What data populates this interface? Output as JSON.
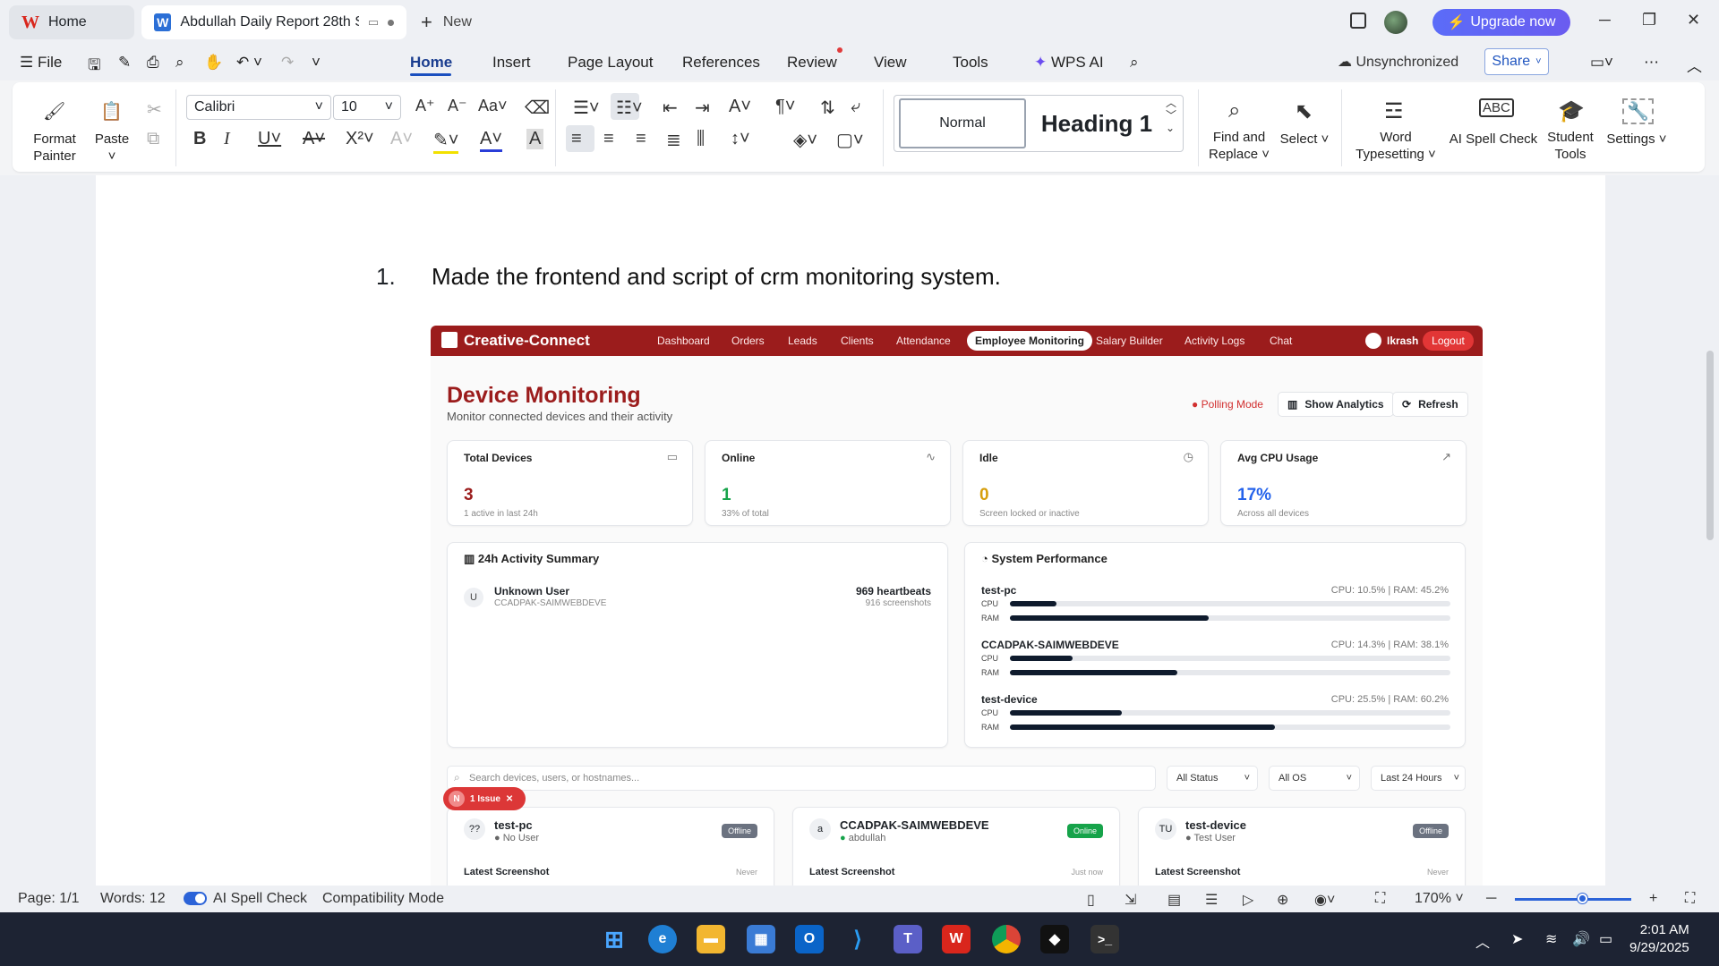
{
  "titlebar": {
    "home_tab": "Home",
    "doc_tab": "Abdullah Daily Report 28th S",
    "new_tab": "New",
    "upgrade": "Upgrade now"
  },
  "menu": {
    "file": "File",
    "tabs": [
      "Home",
      "Insert",
      "Page Layout",
      "References",
      "Review",
      "View",
      "Tools",
      "WPS AI"
    ],
    "unsync": "Unsynchronized",
    "share": "Share"
  },
  "ribbon": {
    "format_painter": [
      "Format",
      "Painter"
    ],
    "paste": "Paste",
    "font": "Calibri",
    "size": "10",
    "style_normal": "Normal",
    "style_h1": "Heading 1",
    "find_replace": [
      "Find and",
      "Replace"
    ],
    "select": "Select",
    "word_typesetting": [
      "Word",
      "Typesetting"
    ],
    "ai_spell": "AI Spell Check",
    "student_tools": [
      "Student",
      "Tools"
    ],
    "settings": "Settings"
  },
  "document": {
    "list_number": "1.",
    "line": "Made the frontend and script of crm monitoring system."
  },
  "crm": {
    "brand": "Creative-Connect",
    "nav": [
      "Dashboard",
      "Orders",
      "Leads",
      "Clients",
      "Attendance",
      "Employee Monitoring",
      "Salary Builder",
      "Activity Logs",
      "Chat"
    ],
    "user": "Ikrash",
    "logout": "Logout",
    "title": "Device Monitoring",
    "subtitle": "Monitor connected devices and their activity",
    "polling": "Polling Mode",
    "show_analytics": "Show Analytics",
    "refresh": "Refresh",
    "stats": [
      {
        "label": "Total Devices",
        "value": "3",
        "note": "1 active in last 24h",
        "color": "#9b1c1c"
      },
      {
        "label": "Online",
        "value": "1",
        "note": "33% of total",
        "color": "#16a34a"
      },
      {
        "label": "Idle",
        "value": "0",
        "note": "Screen locked or inactive",
        "color": "#d69e0b"
      },
      {
        "label": "Avg CPU Usage",
        "value": "17%",
        "note": "Across all devices",
        "color": "#2563eb"
      }
    ],
    "activity": {
      "title": "24h Activity Summary",
      "avatar": "U",
      "name": "Unknown User",
      "host": "CCADPAK-SAIMWEBDEVE",
      "heartbeats": "969 heartbeats",
      "screenshots": "916 screenshots"
    },
    "performance": {
      "title": "System Performance",
      "cpu_label": "CPU",
      "ram_label": "RAM",
      "devices": [
        {
          "name": "test-pc",
          "stat": "CPU: 10.5% | RAM: 45.2%",
          "cpu": 10.5,
          "ram": 45.2
        },
        {
          "name": "CCADPAK-SAIMWEBDEVE",
          "stat": "CPU: 14.3% | RAM: 38.1%",
          "cpu": 14.3,
          "ram": 38.1
        },
        {
          "name": "test-device",
          "stat": "CPU: 25.5% | RAM: 60.2%",
          "cpu": 25.5,
          "ram": 60.2
        }
      ]
    },
    "search_placeholder": "Search devices, users, or hostnames...",
    "filters": [
      "All Status",
      "All OS",
      "Last 24 Hours"
    ],
    "issue": {
      "avatar": "N",
      "label": "1 Issue"
    },
    "devices": [
      {
        "avatar": "??",
        "name": "test-pc",
        "user": "No User",
        "status": "Offline",
        "shot_label": "Latest Screenshot",
        "shot_time": "Never"
      },
      {
        "avatar": "a",
        "name": "CCADPAK-SAIMWEBDEVE",
        "user": "abdullah",
        "status": "Online",
        "shot_label": "Latest Screenshot",
        "shot_time": "Just now"
      },
      {
        "avatar": "TU",
        "name": "test-device",
        "user": "Test User",
        "status": "Offline",
        "shot_label": "Latest Screenshot",
        "shot_time": "Never"
      }
    ]
  },
  "statusbar": {
    "page": "Page: 1/1",
    "words": "Words: 12",
    "ai_spell": "AI Spell Check",
    "mode": "Compatibility Mode",
    "zoom": "170%"
  },
  "taskbar": {
    "time": "2:01 AM",
    "date": "9/29/2025"
  }
}
